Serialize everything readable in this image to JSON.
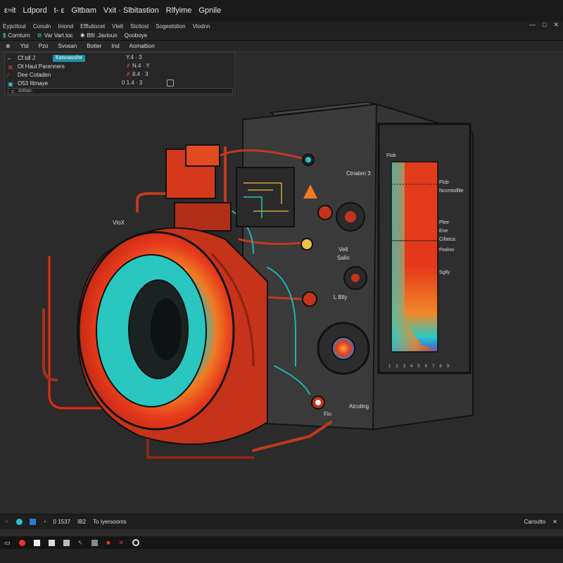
{
  "titlebar": {
    "items": [
      "ε≈it",
      "Ldpord",
      "t- ε",
      "Gltbam",
      "Vxit · Slbitastion",
      "Rlfyime",
      "Gpnile"
    ]
  },
  "menubar": {
    "items": [
      "Eypcitout",
      "Conuln",
      "Iniond",
      "Efflutiocet",
      "Vtelt",
      "Stcitost",
      "Sogestotion",
      "Vlodnn"
    ],
    "controls": [
      "—",
      "□",
      "✕"
    ]
  },
  "toolbar": {
    "items": [
      "Cornturn",
      "Var Vart.toc",
      "Bltl .Javioun",
      "Qooboye"
    ]
  },
  "tabs": [
    "Ytd",
    "Pzo",
    "Svosan",
    "Botter",
    "Ind",
    "Aomattion"
  ],
  "panel": {
    "rows": [
      {
        "label": "Cf.tdl J",
        "chip": "Eatsnassihe",
        "value": "Y.4 · 3"
      },
      {
        "label": "Ot Haut Parenners",
        "value": "N.4 · Y"
      },
      {
        "label": "Dee Cotaden",
        "value": "8.4 · 3"
      },
      {
        "label": "O53 Iltmaye",
        "value": "0 1.4 · 3"
      }
    ],
    "search_placeholder": "Attfain"
  },
  "diagram": {
    "labels": {
      "left": "VloX",
      "right_top": "Ctnaten 3",
      "right_mid_a": "Velt",
      "right_mid_b": "Salin",
      "right_lower": "L Blly",
      "bottom": "Alcoling",
      "fin": "Fin"
    },
    "legend": [
      "Flob",
      "Ncomtolfile",
      "Plee",
      "Ene",
      "Cillatca",
      "Ftolino",
      "Sglly"
    ],
    "axis_ticks": [
      "1",
      "2",
      "3",
      "4",
      "5",
      "6",
      "7",
      "8",
      "9"
    ]
  },
  "statusbar": {
    "items": [
      "0 1537",
      "IB2",
      "To Iyersoonts"
    ],
    "right": "Caroutto"
  },
  "colors": {
    "accent": "#1e8ea4",
    "hot": "#e23b1c",
    "cool": "#27c3c0",
    "body": "#3a3a3a"
  }
}
